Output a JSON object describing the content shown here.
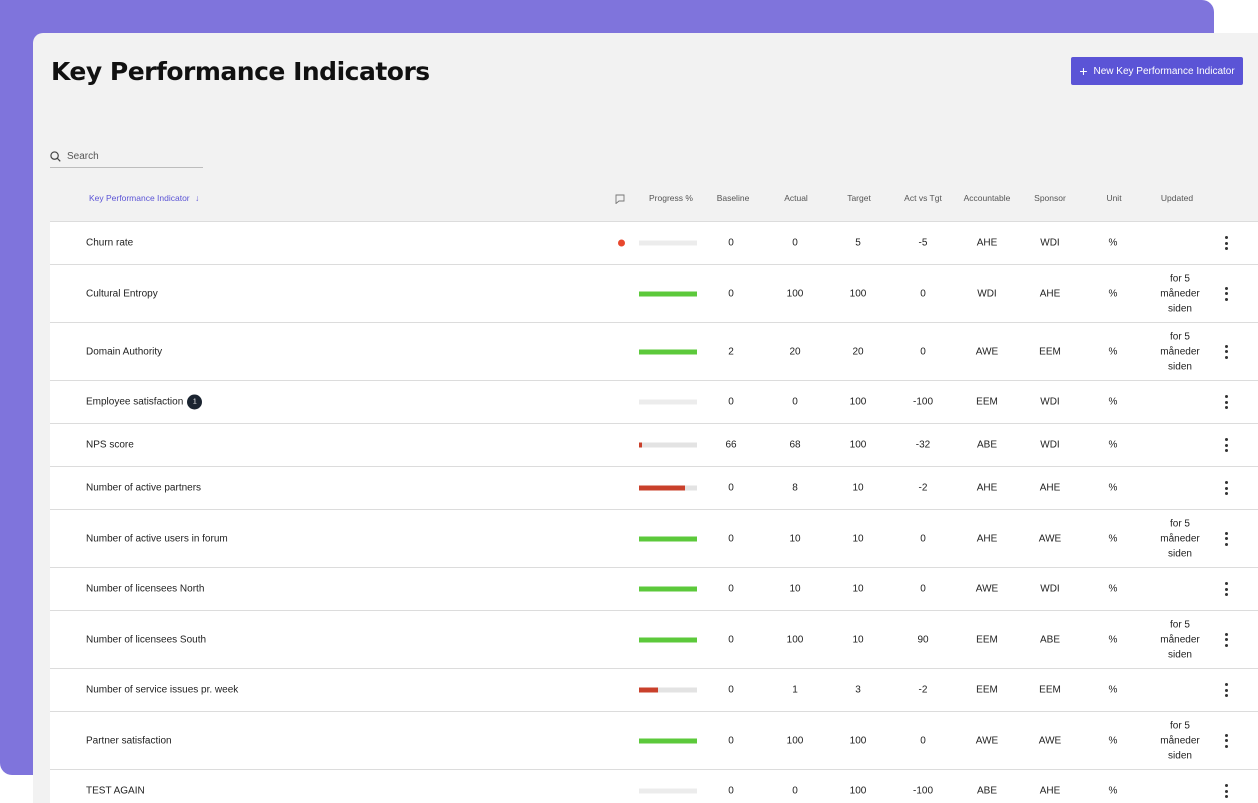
{
  "header": {
    "title": "Key Performance Indicators",
    "new_button_label": "New Key Performance Indicator",
    "new_button_icon": "plus-icon",
    "accent_color": "#5b54d6"
  },
  "search": {
    "placeholder": "Search",
    "value": ""
  },
  "columns": {
    "kpi": "Key Performance Indicator",
    "sort_arrow": "↓",
    "progress": "Progress %",
    "baseline": "Baseline",
    "actual": "Actual",
    "target": "Target",
    "act_vs_tgt": "Act vs Tgt",
    "accountable": "Accountable",
    "sponsor": "Sponsor",
    "unit": "Unit",
    "updated": "Updated"
  },
  "colors": {
    "progress_good": "#5cc93b",
    "progress_bad": "#c9402b",
    "alert_dot": "#e8472d"
  },
  "rows": [
    {
      "name": "Churn rate",
      "alert": true,
      "badge": "",
      "progress": 0,
      "status": "bad",
      "baseline": "0",
      "actual": "0",
      "target": "5",
      "act_vs_tgt": "-5",
      "accountable": "AHE",
      "sponsor": "WDI",
      "unit": "%",
      "updated": ""
    },
    {
      "name": "Cultural Entropy",
      "alert": false,
      "badge": "",
      "progress": 100,
      "status": "good",
      "baseline": "0",
      "actual": "100",
      "target": "100",
      "act_vs_tgt": "0",
      "accountable": "WDI",
      "sponsor": "AHE",
      "unit": "%",
      "updated": "for 5 måneder siden"
    },
    {
      "name": "Domain Authority",
      "alert": false,
      "badge": "",
      "progress": 100,
      "status": "good",
      "baseline": "2",
      "actual": "20",
      "target": "20",
      "act_vs_tgt": "0",
      "accountable": "AWE",
      "sponsor": "EEM",
      "unit": "%",
      "updated": "for 5 måneder siden"
    },
    {
      "name": "Employee satisfaction",
      "alert": false,
      "badge": "1",
      "progress": 0,
      "status": "bad",
      "baseline": "0",
      "actual": "0",
      "target": "100",
      "act_vs_tgt": "-100",
      "accountable": "EEM",
      "sponsor": "WDI",
      "unit": "%",
      "updated": ""
    },
    {
      "name": "NPS score",
      "alert": false,
      "badge": "",
      "progress": 5,
      "status": "bad",
      "baseline": "66",
      "actual": "68",
      "target": "100",
      "act_vs_tgt": "-32",
      "accountable": "ABE",
      "sponsor": "WDI",
      "unit": "%",
      "updated": ""
    },
    {
      "name": "Number of active partners",
      "alert": false,
      "badge": "",
      "progress": 80,
      "status": "bad",
      "baseline": "0",
      "actual": "8",
      "target": "10",
      "act_vs_tgt": "-2",
      "accountable": "AHE",
      "sponsor": "AHE",
      "unit": "%",
      "updated": ""
    },
    {
      "name": "Number of active users in forum",
      "alert": false,
      "badge": "",
      "progress": 100,
      "status": "good",
      "baseline": "0",
      "actual": "10",
      "target": "10",
      "act_vs_tgt": "0",
      "accountable": "AHE",
      "sponsor": "AWE",
      "unit": "%",
      "updated": "for 5 måneder siden"
    },
    {
      "name": "Number of licensees North",
      "alert": false,
      "badge": "",
      "progress": 100,
      "status": "good",
      "baseline": "0",
      "actual": "10",
      "target": "10",
      "act_vs_tgt": "0",
      "accountable": "AWE",
      "sponsor": "WDI",
      "unit": "%",
      "updated": ""
    },
    {
      "name": "Number of licensees South",
      "alert": false,
      "badge": "",
      "progress": 100,
      "status": "good",
      "baseline": "0",
      "actual": "100",
      "target": "10",
      "act_vs_tgt": "90",
      "accountable": "EEM",
      "sponsor": "ABE",
      "unit": "%",
      "updated": "for 5 måneder siden"
    },
    {
      "name": "Number of service issues pr. week",
      "alert": false,
      "badge": "",
      "progress": 33,
      "status": "bad",
      "baseline": "0",
      "actual": "1",
      "target": "3",
      "act_vs_tgt": "-2",
      "accountable": "EEM",
      "sponsor": "EEM",
      "unit": "%",
      "updated": ""
    },
    {
      "name": "Partner satisfaction",
      "alert": false,
      "badge": "",
      "progress": 100,
      "status": "good",
      "baseline": "0",
      "actual": "100",
      "target": "100",
      "act_vs_tgt": "0",
      "accountable": "AWE",
      "sponsor": "AWE",
      "unit": "%",
      "updated": "for 5 måneder siden"
    },
    {
      "name": "TEST AGAIN",
      "alert": false,
      "badge": "",
      "progress": 0,
      "status": "bad",
      "baseline": "0",
      "actual": "0",
      "target": "100",
      "act_vs_tgt": "-100",
      "accountable": "ABE",
      "sponsor": "AHE",
      "unit": "%",
      "updated": ""
    }
  ]
}
